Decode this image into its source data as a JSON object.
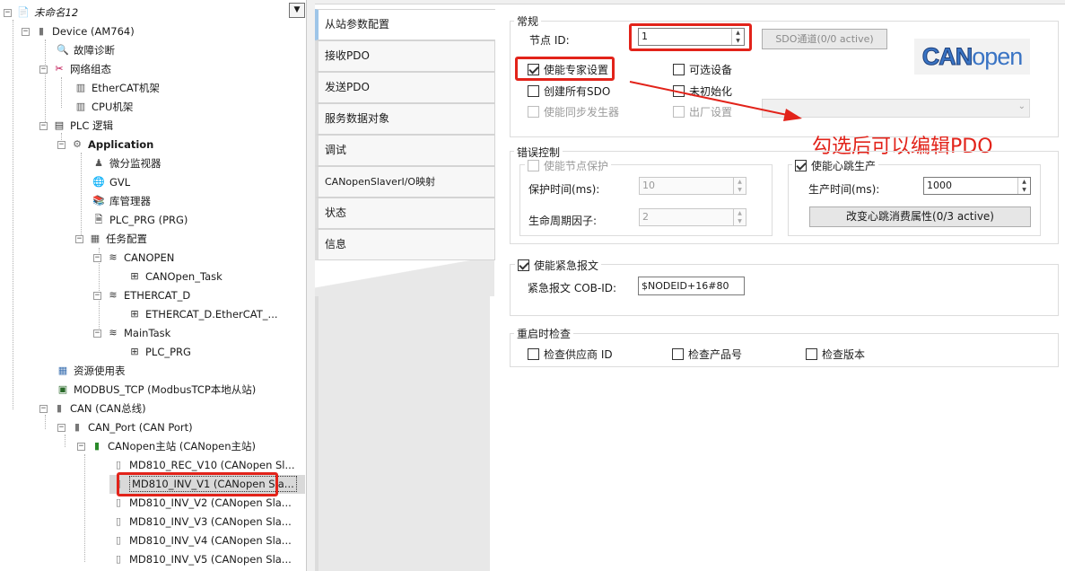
{
  "tree": {
    "root": "未命名12",
    "device": "Device (AM764)",
    "diag": "故障诊断",
    "netcfg": "网络组态",
    "ethercat_rack": "EtherCAT机架",
    "cpu_rack": "CPU机架",
    "plc_logic": "PLC 逻辑",
    "application": "Application",
    "monitor": "微分监视器",
    "gvl": "GVL",
    "libmgr": "库管理器",
    "plc_prg": "PLC_PRG (PRG)",
    "taskcfg": "任务配置",
    "canopen_task_grp": "CANOPEN",
    "canopen_task": "CANOpen_Task",
    "ethercat_d": "ETHERCAT_D",
    "ethercat_d_child": "ETHERCAT_D.EtherCAT_...",
    "maintask": "MainTask",
    "maintask_child": "PLC_PRG",
    "resources": "资源使用表",
    "modbus": "MODBUS_TCP (ModbusTCP本地从站)",
    "can": "CAN (CAN总线)",
    "can_port": "CAN_Port (CAN Port)",
    "canopen_master": "CANopen主站 (CANopen主站)",
    "slave0": "MD810_REC_V10 (CANopen Sl...",
    "slave1": "MD810_INV_V1 (CANopen Sla...",
    "slave2": "MD810_INV_V2 (CANopen Sla...",
    "slave3": "MD810_INV_V3 (CANopen Sla...",
    "slave4": "MD810_INV_V4 (CANopen Sla...",
    "slave5": "MD810_INV_V5 (CANopen Sla..."
  },
  "tabs": [
    "从站参数配置",
    "接收PDO",
    "发送PDO",
    "服务数据对象",
    "调试",
    "CANopenSlaverI/O映射",
    "状态",
    "信息"
  ],
  "general": {
    "title": "常规",
    "node_id_label": "节点 ID:",
    "node_id_value": "1",
    "sdo_btn": "SDO通道(0/0 active)",
    "expert": "使能专家设置",
    "optional": "可选设备",
    "create_sdo": "创建所有SDO",
    "no_init": "未初始化",
    "sync": "使能同步发生器",
    "factory": "出厂设置"
  },
  "annotation": "勾选后可以编辑PDO",
  "error_ctrl": {
    "title": "错误控制",
    "node_guard": "使能节点保护",
    "guard_time_label": "保护时间(ms):",
    "guard_time_value": "10",
    "life_factor_label": "生命周期因子:",
    "life_factor_value": "2",
    "heartbeat": "使能心跳生产",
    "produce_time_label": "生产时间(ms):",
    "produce_time_value": "1000",
    "change_btn": "改变心跳消费属性(0/3 active)"
  },
  "emcy": {
    "enable": "使能紧急报文",
    "cobid_label": "紧急报文 COB-ID:",
    "cobid_value": "$NODEID+16#80"
  },
  "restart": {
    "title": "重启时检查",
    "vendor": "检查供应商 ID",
    "product": "检查产品号",
    "version": "检查版本"
  },
  "logo": {
    "part1": "CAN",
    "part2": "open"
  },
  "colors": {
    "accent": "#e2231a",
    "logo_blue": "#3a74c4",
    "selection": "#cce4f7"
  }
}
